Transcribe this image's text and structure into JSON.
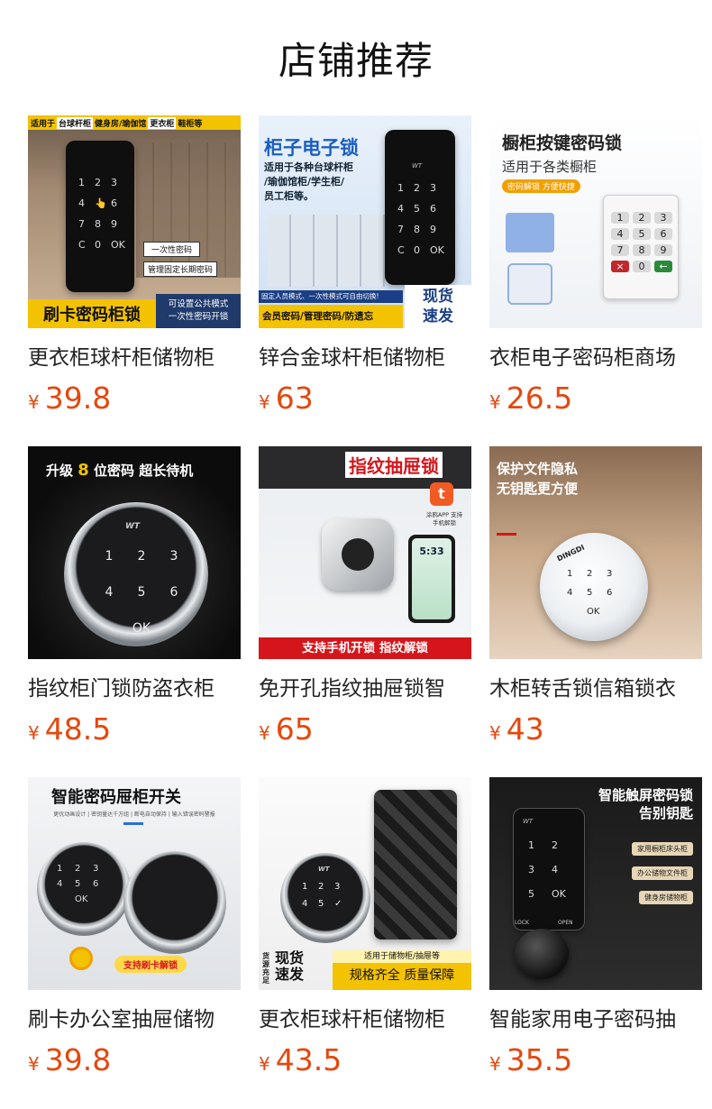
{
  "header": {
    "title": "店铺推荐"
  },
  "products": [
    {
      "title": "更衣柜球杆柜储物柜",
      "currency": "¥",
      "price": "39.8",
      "image": {
        "top_banner": [
          "适用于",
          "台球杆柜",
          "健身房/瑜伽馆",
          "更衣柜",
          "鞋柜等"
        ],
        "tags": [
          "一次性密码",
          "管理固定长期密码"
        ],
        "keys": [
          "1",
          "2",
          "3",
          "4",
          "👆",
          "6",
          "7",
          "8",
          "9",
          "C",
          "0",
          "OK"
        ],
        "bottom_left": "刷卡密码柜锁",
        "bottom_right_1": "可设置公共模式",
        "bottom_right_2": "一次性密码开锁"
      }
    },
    {
      "title": "锌合金球杆柜储物柜",
      "currency": "¥",
      "price": "63",
      "image": {
        "headline": "柜子电子锁",
        "subtitle": [
          "适用于各种台球杆柜",
          "/瑜伽馆柜/学生柜/",
          "员工柜等。"
        ],
        "keys": [
          "1",
          "2",
          "3",
          "4",
          "5",
          "6",
          "7",
          "8",
          "9",
          "C",
          "0",
          "OK"
        ],
        "brand": "WT",
        "strip": "固定人员模式、一次性模式可自由切换!",
        "bottom": "会员密码/管理密码/防遗忘",
        "badge": [
          "现货",
          "速发"
        ]
      }
    },
    {
      "title": "衣柜电子密码柜商场",
      "currency": "¥",
      "price": "26.5",
      "image": {
        "headline": "橱柜按键密码锁",
        "subtitle": "适用于各类橱柜",
        "pill": "密码解锁 方便快捷",
        "keys": [
          "1",
          "2",
          "3",
          "4",
          "5",
          "6",
          "7",
          "8",
          "9",
          "×",
          "0",
          "←"
        ]
      }
    },
    {
      "title": "指纹柜门锁防盗衣柜",
      "currency": "¥",
      "price": "48.5",
      "image": {
        "headline_1": "升级",
        "headline_num": "8",
        "headline_2": "位密码  超长待机",
        "brand": "WT",
        "keys": [
          "1",
          "2",
          "3",
          "4",
          "5",
          "6",
          "OK"
        ]
      }
    },
    {
      "title": "免开孔指纹抽屉锁智",
      "currency": "¥",
      "price": "65",
      "image": {
        "headline": "指纹抽屉锁",
        "app_label": "涂鸦APP 支持手机解锁",
        "phone_time": "5:33",
        "bottom": "支持手机开锁 指纹解锁"
      }
    },
    {
      "title": "木柜转舌锁信箱锁衣",
      "currency": "¥",
      "price": "43",
      "image": {
        "headline_1": "保护文件隐私",
        "headline_2": "无钥匙更方便",
        "brand": "DINGDI",
        "keys": [
          "1",
          "2",
          "3",
          "4",
          "5",
          "6",
          "OK"
        ]
      }
    },
    {
      "title": "刷卡办公室抽屉储物",
      "currency": "¥",
      "price": "39.8",
      "image": {
        "headline": "智能密码屉柜开关",
        "subtitle": "更优动画设计 | 密钥量达千万组 | 断电自动保持 | 输入错误密码警报",
        "keys": [
          "1",
          "2",
          "3",
          "4",
          "5",
          "6",
          "OK"
        ],
        "pill": "支持刷卡解锁"
      }
    },
    {
      "title": "更衣柜球杆柜储物柜",
      "currency": "¥",
      "price": "43.5",
      "image": {
        "brand": "WT",
        "keys": [
          "1",
          "2",
          "3",
          "4",
          "5",
          "✓"
        ],
        "stamp": "货源充足",
        "badge": [
          "现货",
          "速发"
        ],
        "caption_1": "适用于储物柜/抽屉等",
        "caption_2": "规格齐全 质量保障"
      }
    },
    {
      "title": "智能家用电子密码抽",
      "currency": "¥",
      "price": "35.5",
      "image": {
        "headline_1": "智能触屏密码锁",
        "headline_2": "告别钥匙",
        "tags": [
          "家用橱柜床头柜",
          "办公储物文件柜",
          "健身房储物柜"
        ],
        "brand": "WT",
        "keys": [
          "1",
          "2",
          "3",
          "4",
          "5",
          "OK"
        ],
        "lock_label": "LOCK",
        "open_label": "OPEN"
      }
    }
  ]
}
